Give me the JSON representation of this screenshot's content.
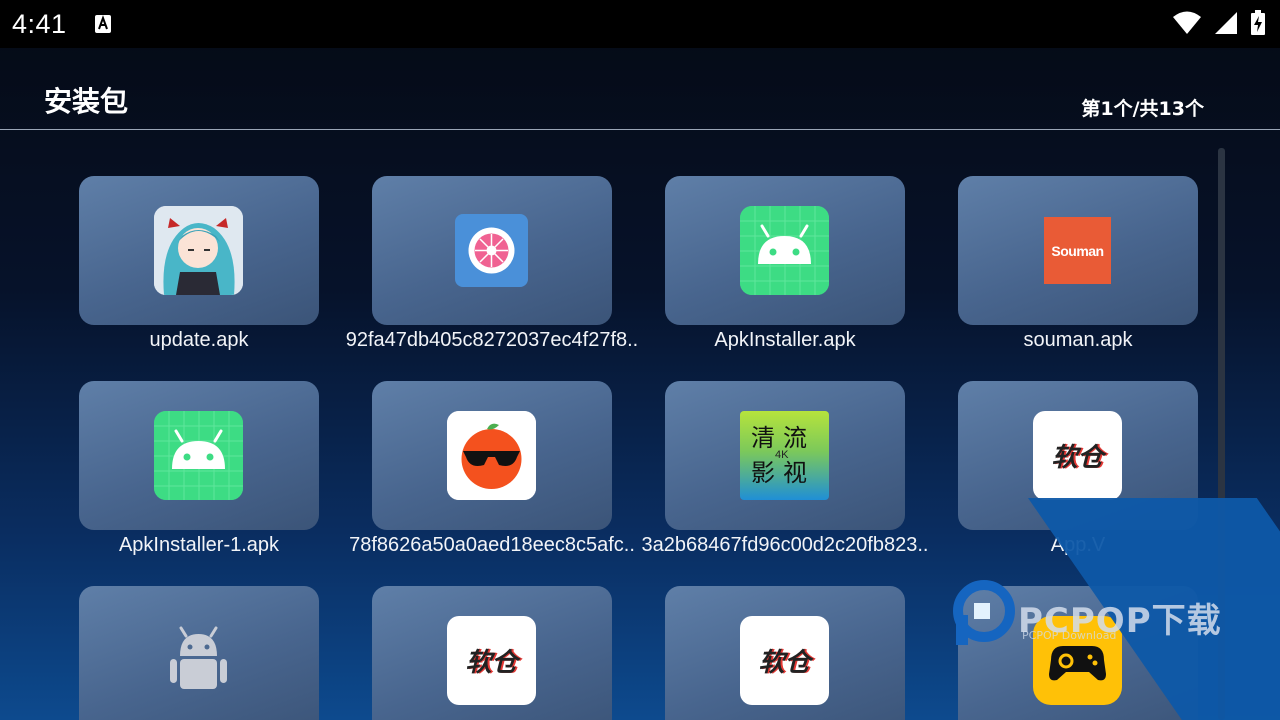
{
  "status": {
    "time": "4:41"
  },
  "header": {
    "title": "安装包",
    "page_count": "第1个/共13个"
  },
  "files": [
    {
      "label": "update.apk",
      "icon": "anime-girl-icon"
    },
    {
      "label": "92fa47db405c8272037ec4f27f8..",
      "icon": "flower-icon"
    },
    {
      "label": "ApkInstaller.apk",
      "icon": "android-icon"
    },
    {
      "label": "souman.apk",
      "icon": "souman-icon",
      "icon_text": "Souman"
    },
    {
      "label": "ApkInstaller-1.apk",
      "icon": "android-icon"
    },
    {
      "label": "78f8626a50a0aed18eec8c5afc..",
      "icon": "orange-sunglasses-icon"
    },
    {
      "label": "3a2b68467fd96c00d2c20fb823..",
      "icon": "qingliu-icon",
      "icon_text": "清流影视",
      "icon_text_small": "4K"
    },
    {
      "label": "App.V",
      "icon": "ruancang-icon",
      "icon_text": "软仓"
    },
    {
      "label": "",
      "icon": "android-gray-icon"
    },
    {
      "label": "",
      "icon": "ruancang-icon",
      "icon_text": "软仓"
    },
    {
      "label": "",
      "icon": "ruancang-icon",
      "icon_text": "软仓"
    },
    {
      "label": "",
      "icon": "gamepad-icon"
    }
  ],
  "watermark": {
    "text": "PCPOP下载",
    "sub": "PCPOP Download"
  },
  "colors": {
    "card": "#5f7fa8",
    "android_green": "#3ddc84",
    "souman_red": "#e95b36",
    "gamepad_yellow": "#ffc107",
    "watermark_blue": "#0e58a8"
  }
}
